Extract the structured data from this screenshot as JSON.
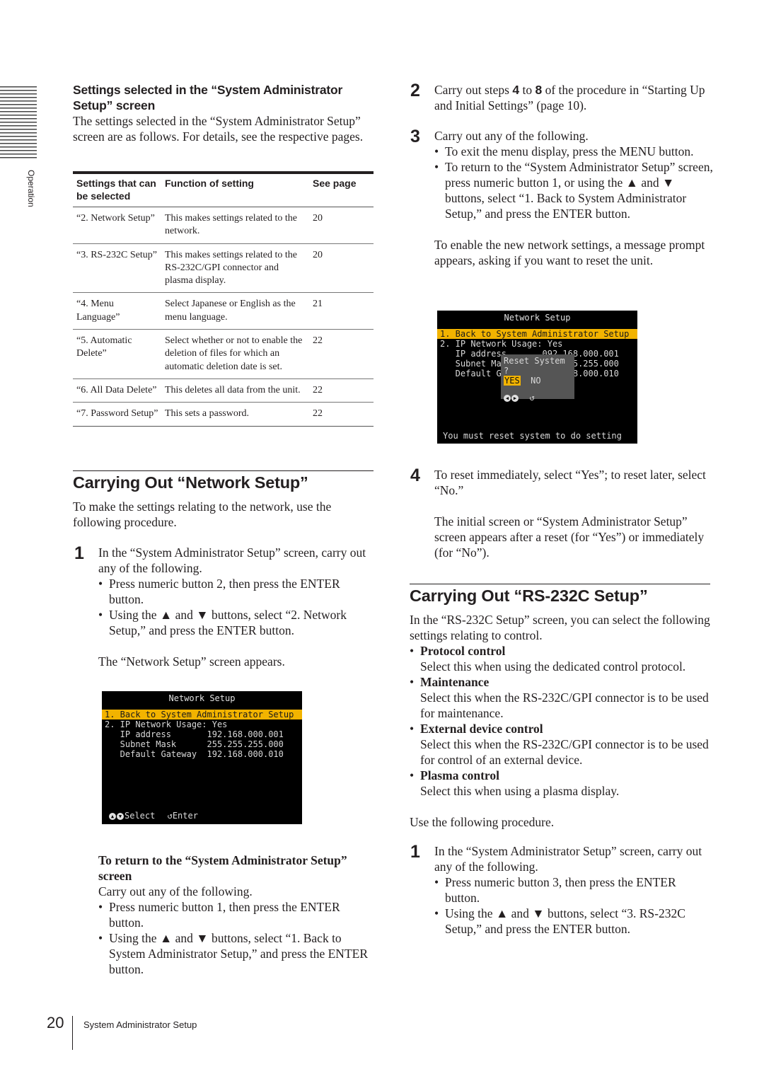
{
  "side_tab": {
    "label": "Operation"
  },
  "settings_section": {
    "heading": "Settings selected in the “System Administrator Setup” screen",
    "intro": "The settings selected in the “System Administrator Setup” screen are as follows. For details, see the respective pages.",
    "table": {
      "headers": [
        "Settings that can be selected",
        "Function of setting",
        "See page"
      ],
      "rows": [
        [
          "“2. Network Setup”",
          "This makes settings related to the network.",
          "20"
        ],
        [
          "“3. RS-232C Setup”",
          "This makes settings related to the RS-232C/GPI connector and plasma display.",
          "20"
        ],
        [
          "“4. Menu Language”",
          "Select Japanese or English as the menu language.",
          "21"
        ],
        [
          "“5. Automatic Delete”",
          "Select whether or not to enable the deletion of files for which an automatic deletion date is set.",
          "22"
        ],
        [
          "“6. All Data Delete”",
          "This deletes all data from the unit.",
          "22"
        ],
        [
          "“7. Password Setup”",
          "This sets a password.",
          "22"
        ]
      ]
    }
  },
  "network_section": {
    "heading": "Carrying Out “Network Setup”",
    "intro": "To make the settings relating to the network, use the following procedure.",
    "step1": {
      "num": "1",
      "text": "In the “System Administrator Setup” screen, carry out any of the following.",
      "bullets": [
        "Press numeric button 2, then press the ENTER button.",
        "Using the ▲ and ▼ buttons, select “2. Network Setup,” and press the ENTER button."
      ],
      "after": "The “Network Setup” screen appears."
    },
    "screen1": {
      "title": "Network Setup",
      "rows": [
        "1. Back to System Administrator Setup",
        "2. IP Network Usage: Yes",
        "   IP address       192.168.000.001",
        "   Subnet Mask      255.255.255.000",
        "   Default Gateway  192.168.000.010"
      ],
      "footer_select": "Select",
      "footer_enter": "Enter"
    },
    "return": {
      "heading": "To return to the “System Administrator Setup” screen",
      "intro": "Carry out any of the following.",
      "bullets": [
        "Press numeric button 1, then press the ENTER button.",
        "Using the ▲ and ▼ buttons, select “1. Back to System Administrator Setup,” and press the ENTER button."
      ]
    },
    "step2": {
      "num": "2",
      "pre": "Carry out steps ",
      "a": "4",
      "mid": " to ",
      "b": "8",
      "post": " of the procedure in “Starting Up and Initial Settings” (page 10)."
    },
    "step3": {
      "num": "3",
      "text": "Carry out any of the following.",
      "bullets": [
        "To exit the menu display, press the MENU button.",
        "To return to the “System Administrator Setup” screen, press numeric button 1, or using the ▲ and ▼ buttons, select “1. Back to System Administrator Setup,” and press the ENTER button."
      ],
      "after": "To enable the new network settings, a message prompt appears, asking if you want to reset the unit."
    },
    "screen2": {
      "title": "Network Setup",
      "rows": [
        "1. Back to System Administrator Setup",
        "2. IP Network Usage: Yes",
        "   IP address       092.168.000.001",
        "   Subnet Mask      255.255.255.000",
        "   Default Gateway  192.168.000.010"
      ],
      "popup_title": "Reset System ?",
      "popup_yes": "YES",
      "popup_no": "NO",
      "message": "You must reset system to do setting"
    },
    "step4": {
      "num": "4",
      "text": "To reset immediately, select “Yes”; to reset later, select “No.”",
      "after": "The initial screen or “System Administrator Setup” screen appears after a reset (for “Yes”) or immediately (for “No”)."
    }
  },
  "rs232_section": {
    "heading": "Carrying Out “RS-232C Setup”",
    "intro": "In the “RS-232C Setup” screen, you can select the following settings relating to control.",
    "options": [
      {
        "name": "Protocol control",
        "desc": "Select this when using the dedicated control protocol."
      },
      {
        "name": "Maintenance",
        "desc": "Select this when the RS-232C/GPI connector is to be used for maintenance."
      },
      {
        "name": "External device control",
        "desc": "Select this when the RS-232C/GPI connector is to be used for control of an external device."
      },
      {
        "name": "Plasma control",
        "desc": "Select this when using a plasma display."
      }
    ],
    "procedure_intro": "Use the following procedure.",
    "step1": {
      "num": "1",
      "text": "In the “System Administrator Setup” screen, carry out any of the following.",
      "bullets": [
        "Press numeric button 3, then press the ENTER button.",
        "Using the ▲ and ▼ buttons, select “3. RS-232C Setup,” and press the ENTER button."
      ]
    }
  },
  "footer": {
    "page_number": "20",
    "section": "System Administrator Setup"
  }
}
